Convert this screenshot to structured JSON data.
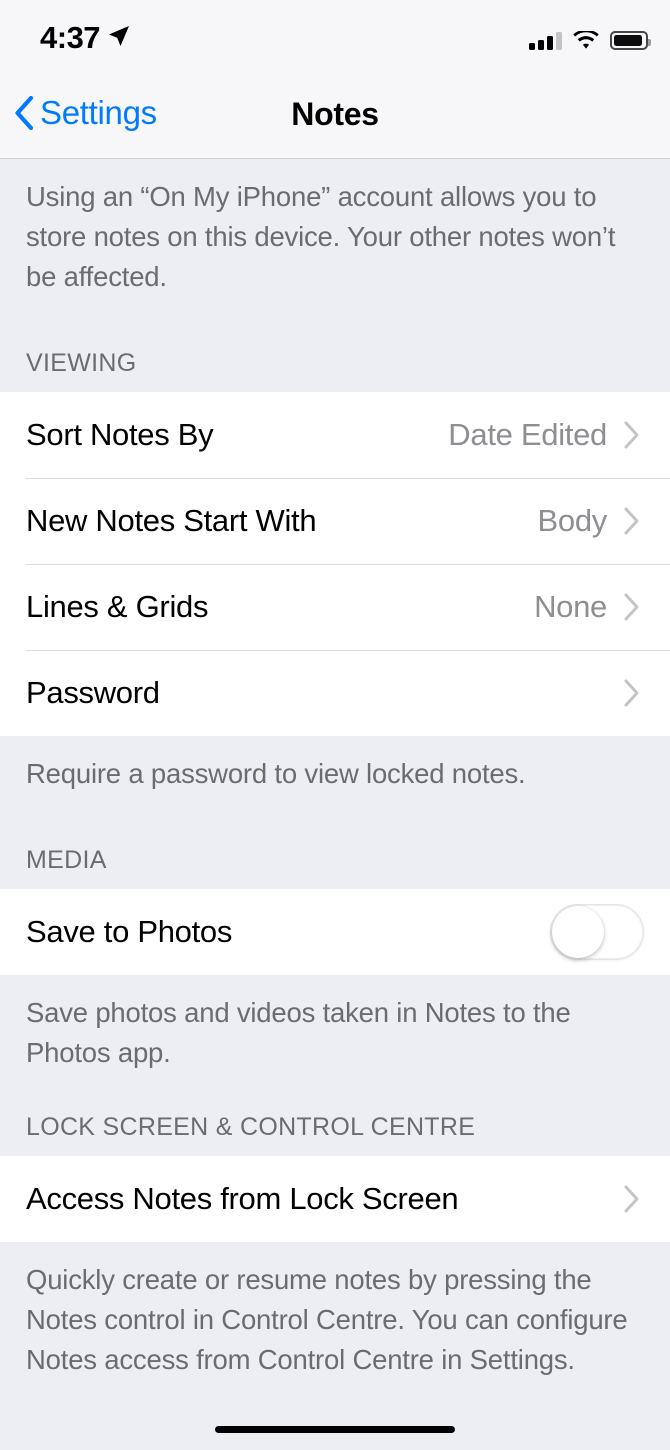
{
  "status_bar": {
    "time": "4:37",
    "location_icon": "location-arrow-icon",
    "cellular_icon": "cellular-bars-icon",
    "wifi_icon": "wifi-icon",
    "battery_icon": "battery-icon"
  },
  "nav": {
    "back_label": "Settings",
    "back_icon": "chevron-left-icon",
    "title": "Notes"
  },
  "intro_footer": "Using an “On My iPhone” account allows you to store notes on this device. Your other notes won’t be affected.",
  "sections": [
    {
      "header": "VIEWING",
      "rows": [
        {
          "label": "Sort Notes By",
          "value": "Date Edited",
          "accessory": "chevron-right-icon"
        },
        {
          "label": "New Notes Start With",
          "value": "Body",
          "accessory": "chevron-right-icon"
        },
        {
          "label": "Lines & Grids",
          "value": "None",
          "accessory": "chevron-right-icon"
        },
        {
          "label": "Password",
          "value": "",
          "accessory": "chevron-right-icon"
        }
      ],
      "footer": "Require a password to view locked notes."
    },
    {
      "header": "MEDIA",
      "rows": [
        {
          "label": "Save to Photos",
          "value": "",
          "accessory": "toggle-switch",
          "toggle_state": "off"
        }
      ],
      "footer": "Save photos and videos taken in Notes to the Photos app."
    },
    {
      "header": "LOCK SCREEN & CONTROL CENTRE",
      "rows": [
        {
          "label": "Access Notes from Lock Screen",
          "value": "",
          "accessory": "chevron-right-icon"
        }
      ],
      "footer": "Quickly create or resume notes by pressing the Notes control in Control Centre. You can configure Notes access from Control Centre in Settings."
    }
  ],
  "home_indicator": "home-indicator",
  "colors": {
    "accent_blue": "#007aff",
    "grouped_background": "#eceef1",
    "cell_background": "#ffffff",
    "secondary_text": "#6c6c70",
    "value_text": "#8e8e93"
  }
}
